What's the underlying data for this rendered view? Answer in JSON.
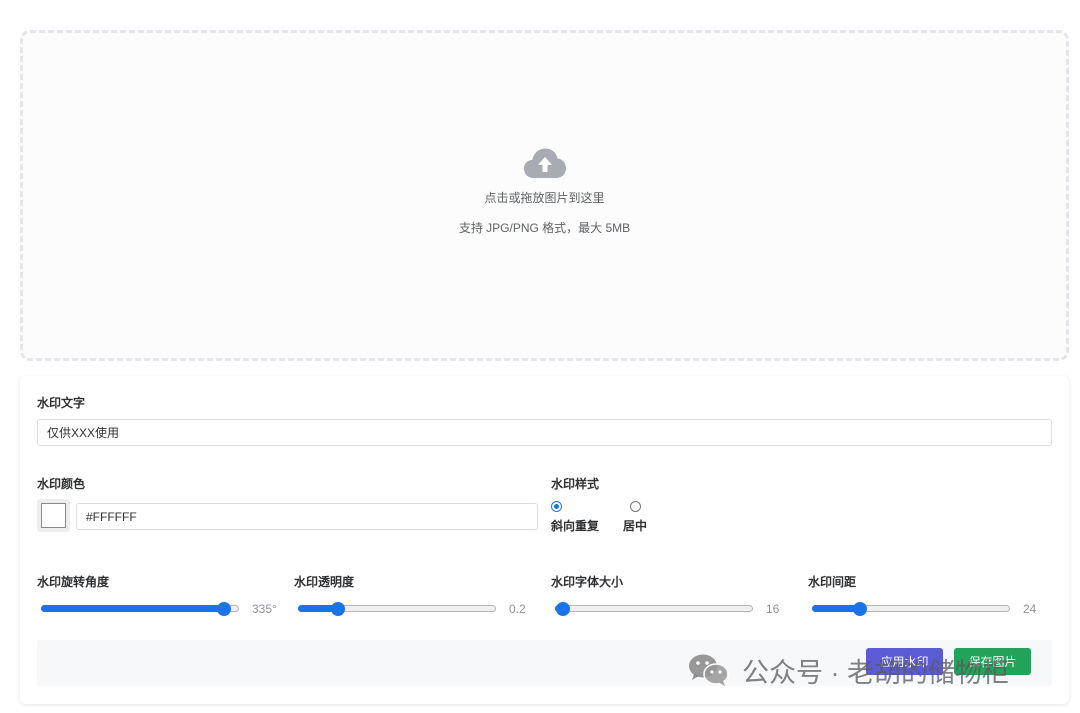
{
  "upload": {
    "icon": "cloud-upload-icon",
    "main_text": "点击或拖放图片到这里",
    "hint_text": "支持 JPG/PNG 格式，最大 5MB"
  },
  "form": {
    "text_label": "水印文字",
    "text_value": "仅供XXX使用",
    "color_label": "水印颜色",
    "color_value": "#FFFFFF",
    "style_label": "水印样式",
    "style_options": [
      {
        "label": "斜向重复",
        "checked": true
      },
      {
        "label": "居中",
        "checked": false
      }
    ],
    "sliders": [
      {
        "label": "水印旋转角度",
        "value": 335,
        "display": "335°",
        "min": 0,
        "max": 360
      },
      {
        "label": "水印透明度",
        "value": 0.2,
        "display": "0.2",
        "min": 0,
        "max": 1
      },
      {
        "label": "水印字体大小",
        "value": 16,
        "display": "16",
        "min": 12,
        "max": 120
      },
      {
        "label": "水印间距",
        "value": 24,
        "display": "24",
        "min": 0,
        "max": 100
      }
    ],
    "apply_label": "应用水印",
    "save_label": "保存图片"
  },
  "overlay": {
    "icon": "wechat-icon",
    "text": "公众号 · 老胡的储物柜"
  },
  "colors": {
    "accent": "#1a73e8",
    "apply": "#5b5bd6",
    "save": "#22a35a"
  }
}
